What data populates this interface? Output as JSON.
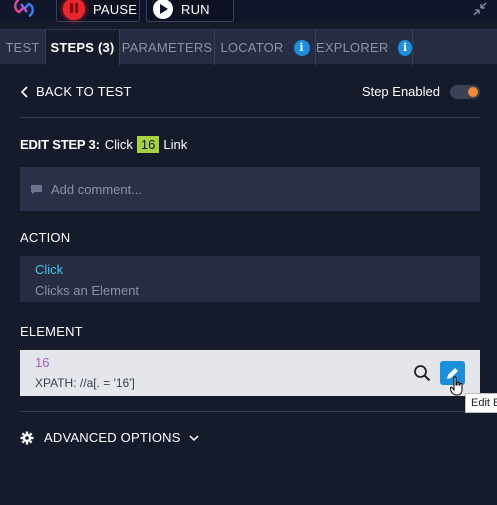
{
  "toolbar": {
    "pause_label": "PAUSE",
    "run_label": "RUN",
    "logo_icon": "app-logo",
    "collapse_icon": "collapse-arrows-icon"
  },
  "tabs": [
    {
      "label": "TEST",
      "active": false
    },
    {
      "label": "STEPS (3)",
      "active": true
    },
    {
      "label": "PARAMETERS",
      "active": false
    },
    {
      "label": "LOCATOR",
      "active": false,
      "info": "i"
    },
    {
      "label": "EXPLORER",
      "active": false,
      "info": "i"
    }
  ],
  "nav": {
    "back_label": "BACK TO TEST",
    "step_enabled_label": "Step Enabled",
    "step_enabled": true
  },
  "edit": {
    "title_prefix": "EDIT STEP 3:",
    "action_word": "Click",
    "element_badge": "16",
    "element_type": "Link",
    "comment_placeholder": "Add comment..."
  },
  "action": {
    "section_label": "ACTION",
    "name": "Click",
    "description": "Clicks an Element"
  },
  "element": {
    "section_label": "ELEMENT",
    "name": "16",
    "xpath": "XPATH: //a[. = '16']",
    "tooltip": "Edit E"
  },
  "advanced": {
    "label": "ADVANCED OPTIONS"
  },
  "colors": {
    "background": "#161b2c",
    "tab_bar": "#262c41",
    "accent_blue": "#1b8fdc",
    "badge_green": "#a5d23f",
    "action_cyan": "#3ec6ea",
    "element_purple": "#a75ad9",
    "toggle_orange": "#f08a3c",
    "pause_red": "#e8262b"
  }
}
